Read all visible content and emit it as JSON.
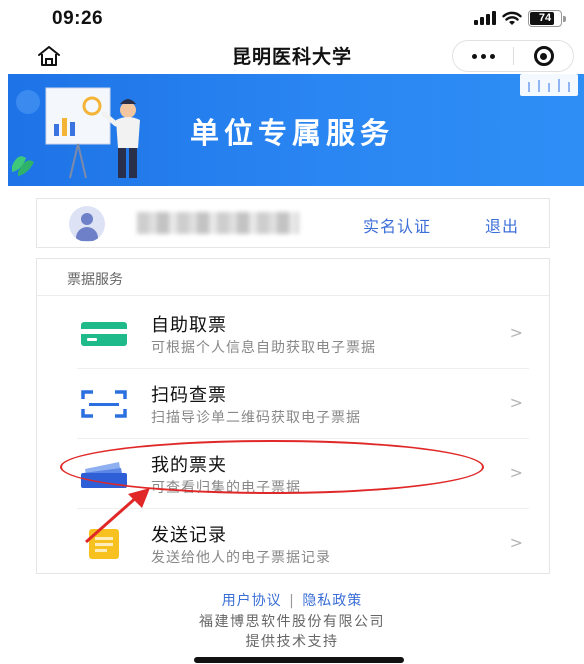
{
  "status_bar": {
    "time": "09:26",
    "battery_level": "74",
    "icons": [
      "signal-icon",
      "wifi-icon",
      "battery-icon"
    ]
  },
  "nav": {
    "title": "昆明医科大学",
    "home_icon": "home-icon",
    "more_icon": "more-icon",
    "close_icon": "target-close-icon"
  },
  "banner": {
    "title": "单位专属服务",
    "colors": {
      "start": "#1e73e6",
      "end": "#2f8ef6"
    }
  },
  "user_card": {
    "real_name_label": "实名认证",
    "logout_label": "退出"
  },
  "services": {
    "section_label": "票据服务",
    "items": [
      {
        "title": "自助取票",
        "desc": "可根据个人信息自助获取电子票据",
        "icon": "card-icon"
      },
      {
        "title": "扫码查票",
        "desc": "扫描导诊单二维码获取电子票据",
        "icon": "scan-icon"
      },
      {
        "title": "我的票夹",
        "desc": "可查看归集的电子票据",
        "icon": "wallet-icon"
      },
      {
        "title": "发送记录",
        "desc": "发送给他人的电子票据记录",
        "icon": "send-record-icon"
      }
    ],
    "chevron": ">"
  },
  "footer": {
    "agreement": "用户协议",
    "separator": "|",
    "privacy": "隐私政策",
    "company": "福建博思软件股份有限公司",
    "support": "提供技术支持"
  },
  "colors": {
    "accent": "#3d6fd8",
    "annotation": "#e02828"
  }
}
